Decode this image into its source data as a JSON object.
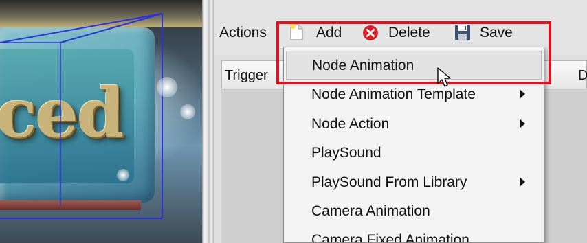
{
  "viewport": {
    "preview_text": "ced"
  },
  "toolbar": {
    "actions_label": "Actions",
    "add_label": "Add",
    "delete_label": "Delete",
    "save_label": "Save"
  },
  "grid": {
    "columns": [
      "Trigger",
      "D"
    ]
  },
  "menu": {
    "items": [
      {
        "label": "Node Animation",
        "submenu": false,
        "selected": true
      },
      {
        "label": "Node Animation Template",
        "submenu": true
      },
      {
        "label": "Node Action",
        "submenu": true
      },
      {
        "label": "PlaySound",
        "submenu": false
      },
      {
        "label": "PlaySound From Library",
        "submenu": true
      },
      {
        "label": "Camera Animation",
        "submenu": false
      },
      {
        "label": "Camera Fixed Animation",
        "submenu": false
      }
    ]
  },
  "icons": {
    "add": "new-document-icon",
    "delete": "delete-circle-icon",
    "save": "floppy-disk-icon",
    "submenu": "submenu-arrow-icon",
    "cursor": "mouse-pointer-icon"
  },
  "colors": {
    "highlight_box": "#e0101c",
    "delete_icon": "#d8202a",
    "save_icon": "#3b4f6e"
  }
}
